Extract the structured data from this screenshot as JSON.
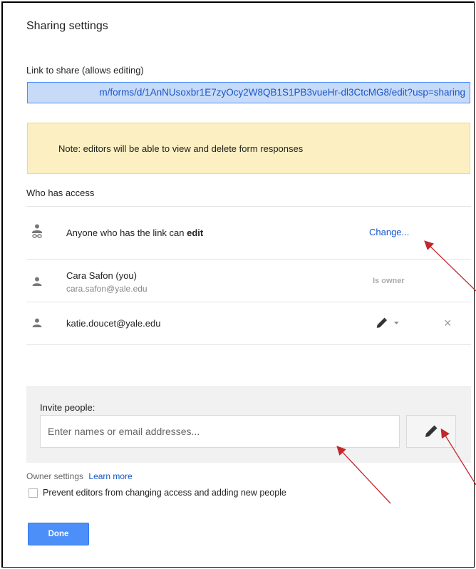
{
  "dialog": {
    "title": "Sharing settings",
    "link_label": "Link to share (allows editing)",
    "link_value": "m/forms/d/1AnNUsoxbr1E7zyOcy2W8QB1S1PB3vueHr-dl3CtcMG8/edit?usp=sharing",
    "note": "Note: editors will be able to view and delete form responses",
    "who_label": "Who has access"
  },
  "access": {
    "link_row": {
      "text_prefix": "Anyone who has the link can ",
      "text_strong": "edit",
      "change_label": "Change..."
    },
    "owner_row": {
      "name": "Cara Safon (you)",
      "email": "cara.safon@yale.edu",
      "role": "Is owner"
    },
    "editor_row": {
      "email": "katie.doucet@yale.edu",
      "remove_label": "×"
    }
  },
  "invite": {
    "label": "Invite people:",
    "placeholder": "Enter names or email addresses..."
  },
  "owner_settings": {
    "label": "Owner settings",
    "learn_more": "Learn more",
    "prevent_label": "Prevent editors from changing access and adding new people"
  },
  "done_label": "Done",
  "colors": {
    "accent": "#4d8ff8",
    "link": "#1155cc",
    "note_bg": "#fcefc2",
    "arrow": "#c0282d"
  }
}
